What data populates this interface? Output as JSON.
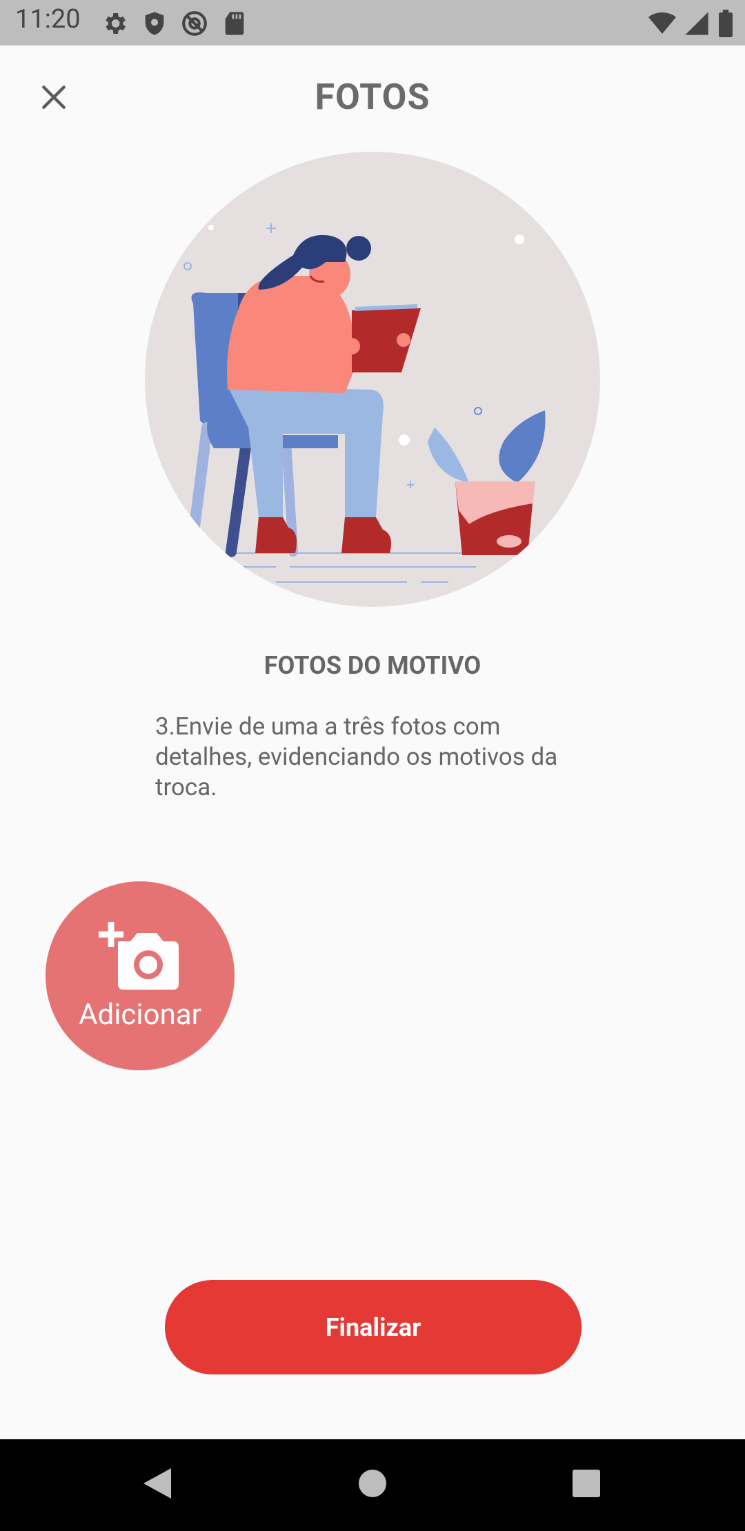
{
  "status_bar": {
    "time": "11:20",
    "left_icons": [
      "settings-icon",
      "shield-icon",
      "at-sign-icon",
      "sd-card-icon"
    ],
    "right_icons": [
      "wifi-icon",
      "signal-icon",
      "battery-icon"
    ]
  },
  "header": {
    "title": "FOTOS",
    "close_icon": "close-icon"
  },
  "content": {
    "section_title": "FOTOS DO MOTIVO",
    "description": "3.Envie de uma a três fotos com detalhes, evidenciando os motivos da troca."
  },
  "add_photo": {
    "label": "Adicionar",
    "icon": "add-camera-icon",
    "color": "#e57373"
  },
  "finish_button": {
    "label": "Finalizar",
    "color": "#e53935"
  },
  "nav_bar": {
    "icons": [
      "back-icon",
      "home-icon",
      "recents-icon"
    ]
  }
}
